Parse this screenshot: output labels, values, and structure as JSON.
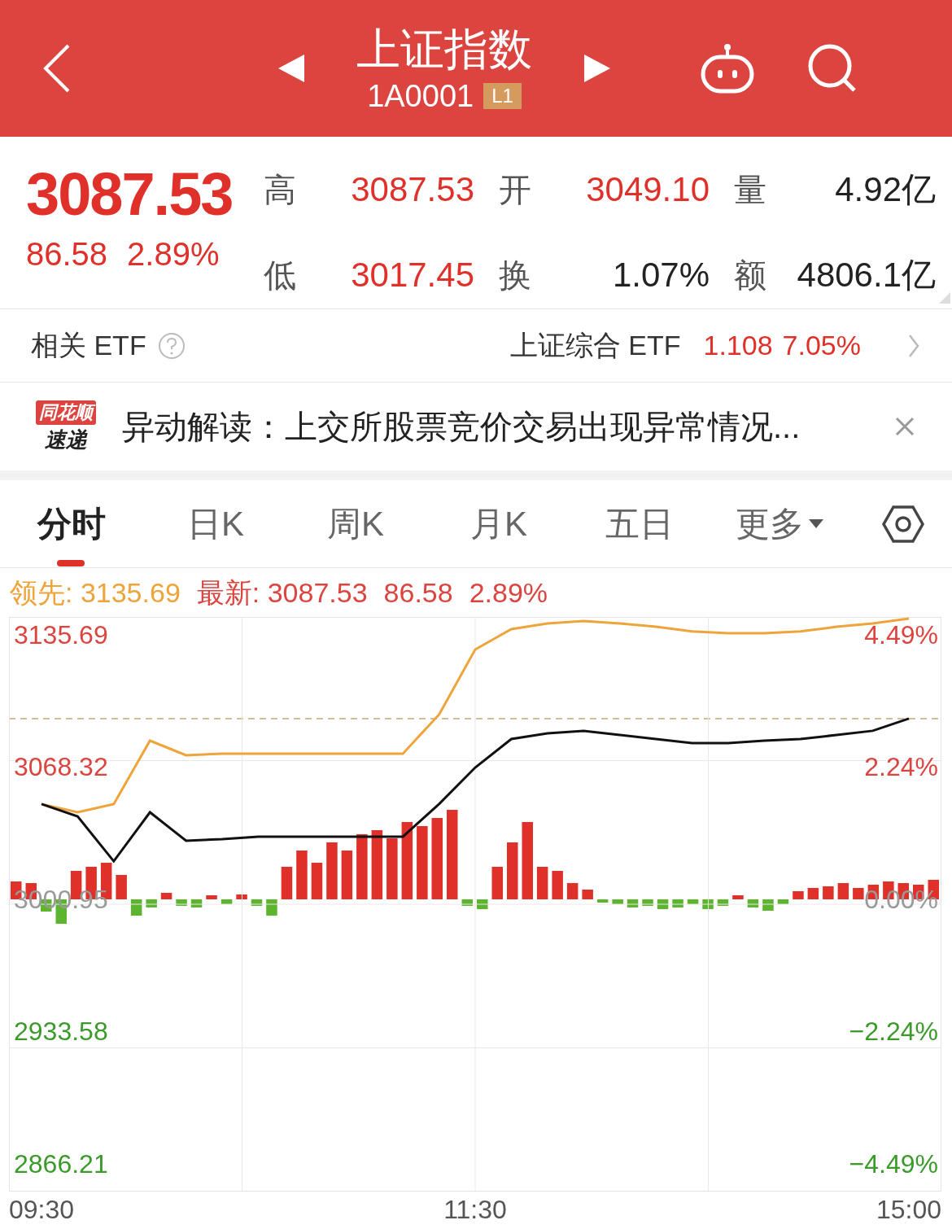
{
  "header": {
    "title": "上证指数",
    "code": "1A0001",
    "level_badge": "L1"
  },
  "quote": {
    "price": "3087.53",
    "change": "86.58",
    "change_pct": "2.89%",
    "stats": [
      {
        "label": "高",
        "value": "3087.53",
        "color": "#e0302a"
      },
      {
        "label": "开",
        "value": "3049.10",
        "color": "#e0302a"
      },
      {
        "label": "量",
        "value": "4.92亿",
        "color": "#222222"
      },
      {
        "label": "低",
        "value": "3017.45",
        "color": "#e0302a"
      },
      {
        "label": "换",
        "value": "1.07%",
        "color": "#222222"
      },
      {
        "label": "额",
        "value": "4806.1亿",
        "color": "#222222"
      }
    ]
  },
  "etf": {
    "label": "相关 ETF",
    "name": "上证综合 ETF",
    "price": "1.108",
    "change_pct": "7.05%"
  },
  "news": {
    "logo_top": "同花顺",
    "logo_bottom": "速递",
    "text": "异动解读：上交所股票竞价交易出现异常情况..."
  },
  "tabs": [
    {
      "label": "分时",
      "selected": true
    },
    {
      "label": "日K",
      "selected": false
    },
    {
      "label": "周K",
      "selected": false
    },
    {
      "label": "月K",
      "selected": false
    },
    {
      "label": "五日",
      "selected": false
    },
    {
      "label": "更多",
      "selected": false,
      "kind": "dropdown"
    }
  ],
  "legend": {
    "lead_label": "领先:",
    "lead_value": "3135.69",
    "last_label": "最新:",
    "last_value": "3087.53",
    "change": "86.58",
    "change_pct": "2.89%"
  },
  "chart": {
    "chart_data": {
      "type": "line",
      "categories": [
        "09:30",
        null,
        null,
        null,
        null,
        null,
        null,
        null,
        null,
        null,
        null,
        null,
        "11:30",
        null,
        null,
        null,
        null,
        null,
        null,
        null,
        null,
        null,
        null,
        null,
        "15:00"
      ],
      "series": [
        {
          "color": "#eea43a",
          "values": [
            3049.5,
            3045.3,
            3049.5,
            3081.8,
            3074.3,
            3075.2,
            3075.2,
            3075.2,
            3075.2,
            3075.2,
            3075.2,
            3095.1,
            3128.2,
            3138.6,
            3141.5,
            3142.7,
            3141.5,
            3139.8,
            3137.4,
            3136.5,
            3136.5,
            3137.4,
            3139.8,
            3141.5,
            3144.0
          ]
        },
        {
          "color": "#111111",
          "values": [
            3049.5,
            3043.2,
            3020.4,
            3045.3,
            3030.8,
            3031.6,
            3032.9,
            3032.9,
            3032.9,
            3032.9,
            3032.9,
            3049.5,
            3068.1,
            3082.6,
            3085.5,
            3086.8,
            3084.7,
            3082.6,
            3080.6,
            3080.6,
            3081.8,
            3082.6,
            3084.7,
            3086.8,
            3093.0
          ]
        }
      ],
      "ylim": [
        2852.1,
        3144.8
      ],
      "yticks": [
        {
          "value": 3135.69,
          "label": "3135.69"
        },
        {
          "value": 3068.32,
          "label": "3068.32"
        },
        {
          "value": 3000.95,
          "label": "3000.95"
        },
        {
          "value": 2933.58,
          "label": "2933.58"
        },
        {
          "value": 2866.21,
          "label": "2866.21"
        }
      ],
      "grid": true
    },
    "percent_labels": [
      "4.49%",
      "2.24%",
      "0.00%",
      "−2.24%",
      "−4.49%"
    ]
  }
}
